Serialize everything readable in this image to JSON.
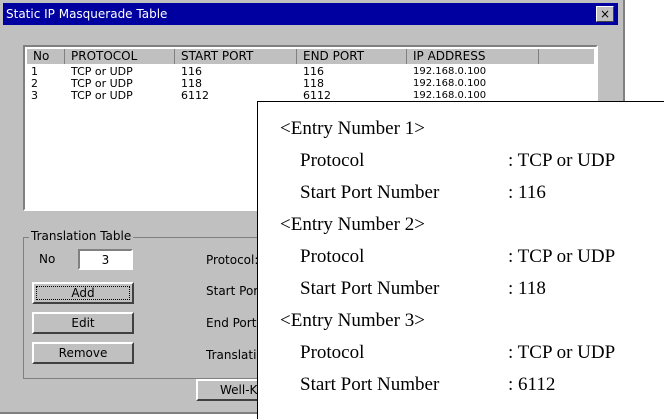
{
  "window": {
    "title": "Static IP Masquerade Table",
    "close_label": "×"
  },
  "table": {
    "headers": [
      "No",
      "PROTOCOL",
      "START PORT",
      "END PORT",
      "IP ADDRESS"
    ],
    "rows": [
      [
        "1",
        "TCP or UDP",
        "116",
        "116",
        "192.168.0.100"
      ],
      [
        "2",
        "TCP or UDP",
        "118",
        "118",
        "192.168.0.100"
      ],
      [
        "3",
        "TCP or UDP",
        "6112",
        "6112",
        "192.168.0.100"
      ]
    ]
  },
  "translation": {
    "group_label": "Translation Table",
    "no_label": "No",
    "no_value": "3",
    "add": "Add",
    "edit": "Edit",
    "remove": "Remove",
    "protocol_label": "Protocol:",
    "start_port_label": "Start Por",
    "end_port_label": "End Port",
    "translation_label": "Translati",
    "well_known_label": "Well-K"
  },
  "popup": {
    "entries": [
      {
        "heading": "<Entry Number 1>",
        "protocol_label": "Protocol",
        "protocol_value": ": TCP or UDP",
        "port_label": "Start Port Number",
        "port_value": ": 116"
      },
      {
        "heading": "<Entry Number 2>",
        "protocol_label": "Protocol",
        "protocol_value": ": TCP or UDP",
        "port_label": "Start Port Number",
        "port_value": ": 118"
      },
      {
        "heading": "<Entry Number 3>",
        "protocol_label": "Protocol",
        "protocol_value": ": TCP or UDP",
        "port_label": "Start Port Number",
        "port_value": ": 6112"
      }
    ]
  }
}
